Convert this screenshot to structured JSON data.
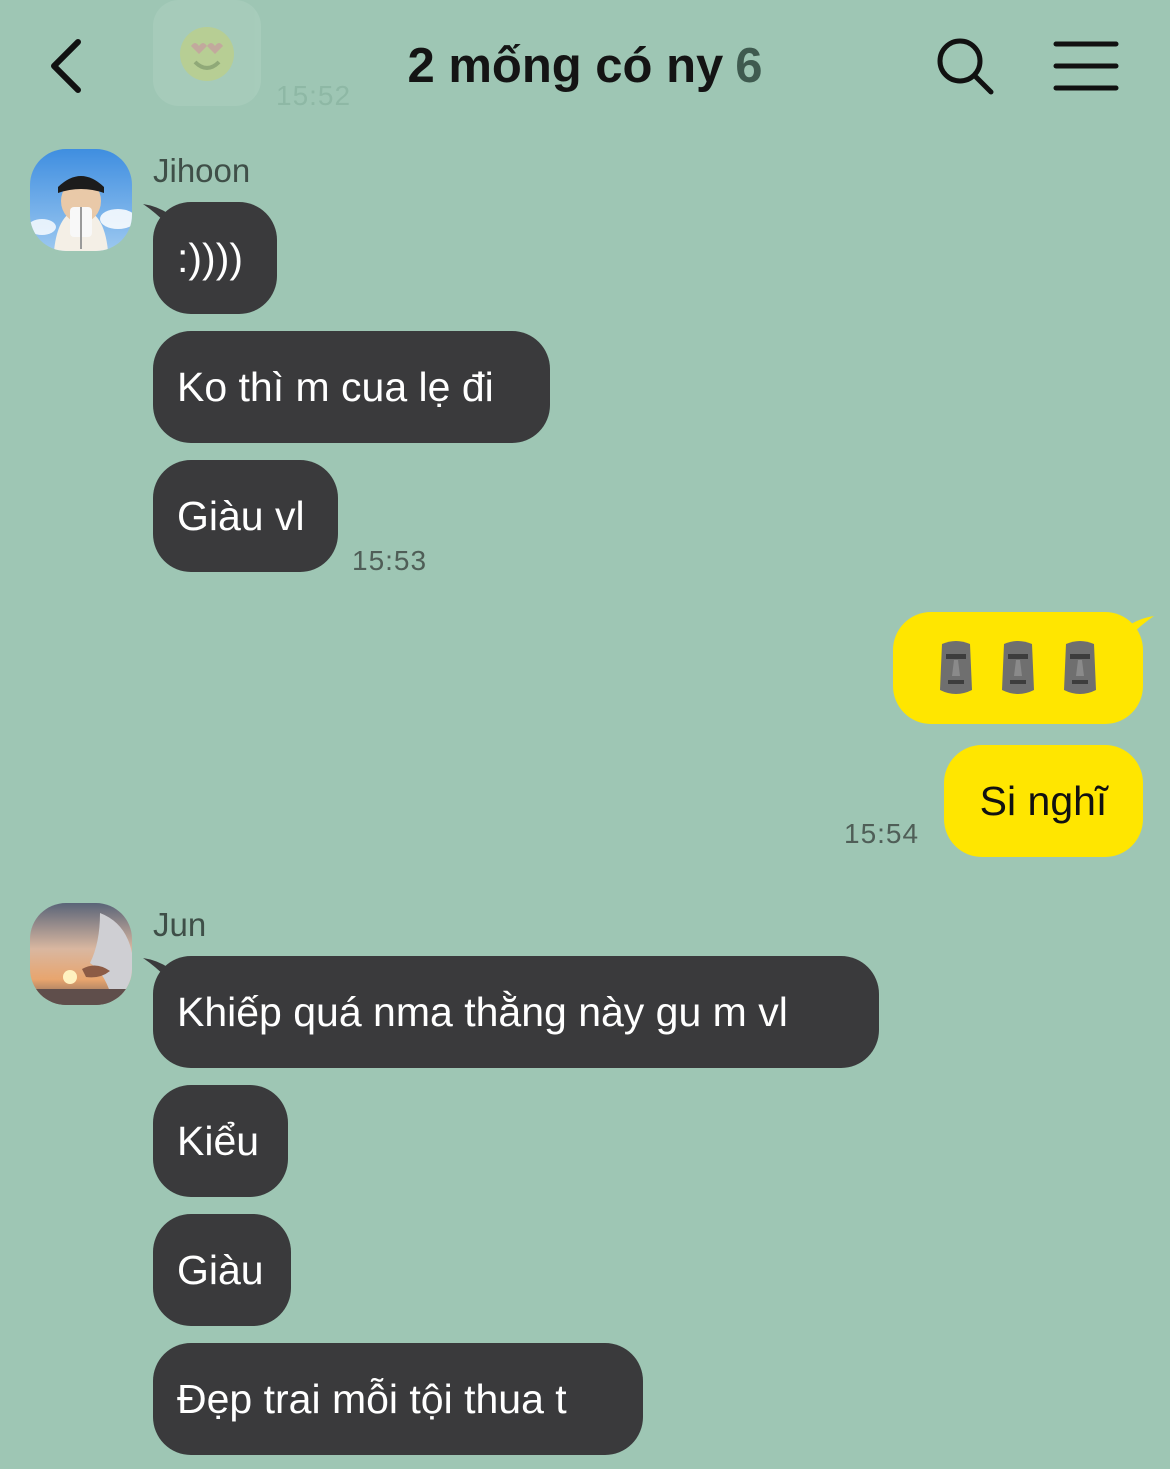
{
  "header": {
    "title": "2 mống có ny",
    "member_count": "6",
    "icons": [
      "back-icon",
      "search-icon",
      "menu-icon"
    ]
  },
  "previous": {
    "sticker_icon": "heart-eyes-face-icon",
    "time": "15:52"
  },
  "groups": [
    {
      "sender": "Jihoon",
      "messages": [
        ":))))",
        "Ko thì m cua lẹ đi",
        "Giàu vl"
      ],
      "time": "15:53"
    },
    {
      "sender": "me",
      "emoji_message": [
        "moai-icon",
        "moai-icon",
        "moai-icon"
      ],
      "messages": [
        "Si nghĩ"
      ],
      "time": "15:54"
    },
    {
      "sender": "Jun",
      "messages": [
        "Khiếp quá nma thằng này gu m vl",
        "Kiểu",
        "Giàu",
        "Đẹp trai mỗi tội thua t"
      ]
    }
  ],
  "colors": {
    "background": "#9ec6b4",
    "incoming_bubble": "#3a3a3c",
    "outgoing_bubble": "#ffe600"
  }
}
